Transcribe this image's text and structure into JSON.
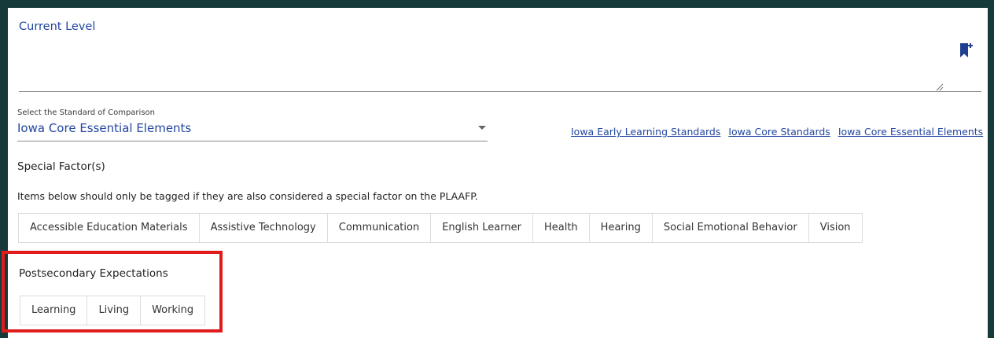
{
  "current_level": {
    "label": "Current Level"
  },
  "standard": {
    "label": "Select the Standard of Comparison",
    "value": "Iowa Core Essential Elements",
    "links": [
      "Iowa Early Learning Standards",
      "Iowa Core Standards",
      "Iowa Core Essential Elements"
    ]
  },
  "special_factors": {
    "title": "Special Factor(s)",
    "note": "Items below should only be tagged if they are also considered a special factor on the PLAAFP.",
    "chips": [
      "Accessible Education Materials",
      "Assistive Technology",
      "Communication",
      "English Learner",
      "Health",
      "Hearing",
      "Social Emotional Behavior",
      "Vision"
    ]
  },
  "postsecondary": {
    "title": "Postsecondary Expectations",
    "chips": [
      "Learning",
      "Living",
      "Working"
    ]
  },
  "colors": {
    "accent": "#2346a0",
    "highlight": "#e01b1b",
    "frame": "#163a3a"
  }
}
